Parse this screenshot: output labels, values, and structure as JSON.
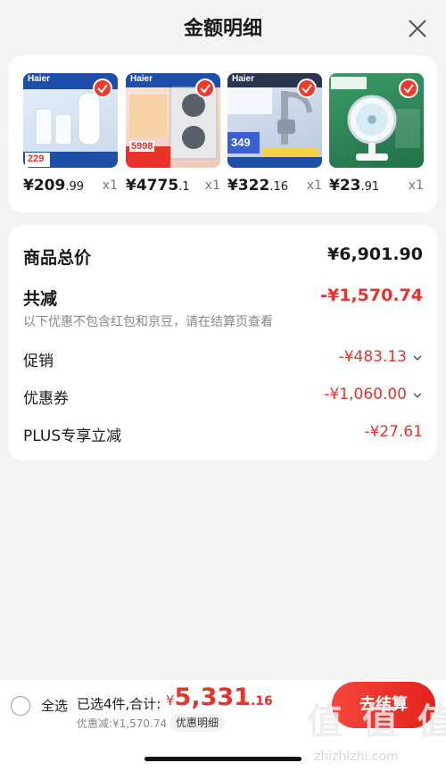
{
  "header": {
    "title": "金额明细",
    "close_icon": "close-icon"
  },
  "products": [
    {
      "brand": "Haier",
      "badge": "229",
      "price_int": "¥209",
      "price_dec": ".99",
      "qty": "x1",
      "thumb_color": "#d9e6f4",
      "icon": "water-purifier-icon"
    },
    {
      "brand": "Haier",
      "badge": "5998",
      "price_int": "¥4775",
      "price_dec": ".1",
      "qty": "x1",
      "thumb_color": "#f1d9cf",
      "icon": "washer-dryer-icon"
    },
    {
      "brand": "Haier",
      "badge": "349",
      "price_int": "¥322",
      "price_dec": ".16",
      "qty": "x1",
      "thumb_color": "#d6e0ee",
      "icon": "faucet-heater-icon"
    },
    {
      "brand": "",
      "badge": "",
      "price_int": "¥23",
      "price_dec": ".91",
      "qty": "x1",
      "thumb_color": "#2f8a58",
      "icon": "desk-fan-icon"
    }
  ],
  "summary": {
    "total_label": "商品总价",
    "total_value": "¥6,901.90",
    "reduce_label": "共减",
    "reduce_value": "-¥1,570.74",
    "hint": "以下优惠不包含红包和京豆，请在结算页查看",
    "promo_label": "促销",
    "promo_value": "-¥483.13",
    "coupon_label": "优惠券",
    "coupon_value": "-¥1,060.00",
    "plus_label": "PLUS专享立减",
    "plus_value": "-¥27.61"
  },
  "bottom": {
    "select_all": "全选",
    "selected_info": "已选4件,合计:",
    "total_currency": "¥",
    "total_int": "5,331",
    "total_dec": ".16",
    "discount_text": "优惠减:¥1,570.74",
    "detail_tag": "优惠明细",
    "checkout_label": "去结算"
  },
  "watermark": {
    "glyphs": "值 值 值",
    "url": "zhizhizhi.com"
  },
  "colors": {
    "accent": "#e8322a",
    "background": "#f3f3f3",
    "card": "#ffffff"
  }
}
